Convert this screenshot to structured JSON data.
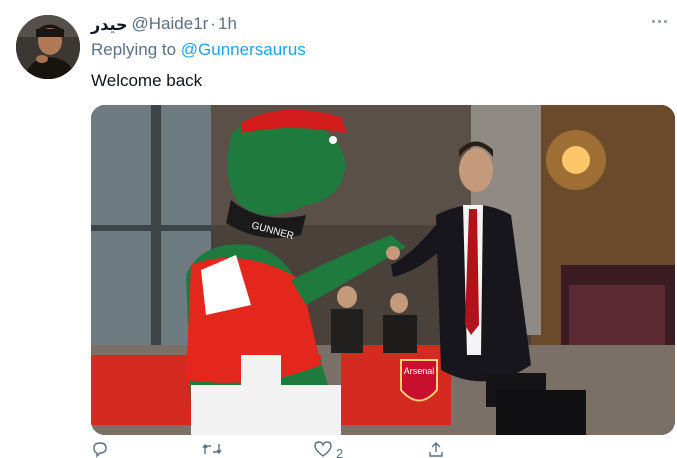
{
  "tweet": {
    "display_name": "حيدر",
    "handle": "@Haide1r",
    "separator": "·",
    "timestamp": "1h",
    "replying_prefix": "Replying to",
    "replying_to": "@Gunnersaurus",
    "text": "Welcome back",
    "like_count": "2"
  },
  "media": {
    "banner_text": "Arsenal",
    "mascot_collar_text": "GUNNER"
  },
  "icons": {
    "more": "more-horizontal-icon",
    "reply": "reply-icon",
    "retweet": "retweet-icon",
    "like": "heart-icon",
    "share": "share-icon"
  },
  "colors": {
    "link": "#1da1f2",
    "secondary_text": "#5b7083",
    "primary_text": "#0f1419",
    "arsenal_red": "#d31b1b"
  }
}
